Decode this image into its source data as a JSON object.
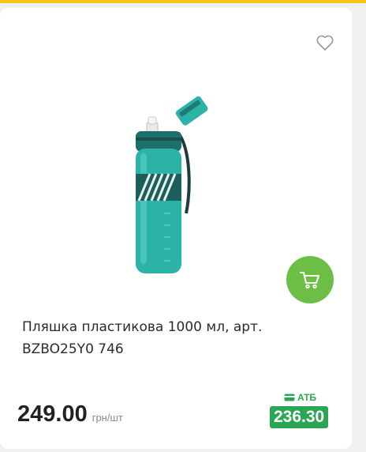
{
  "icons": {
    "favorite": "heart-icon",
    "cart": "cart-icon",
    "atb_card": "card-icon"
  },
  "colors": {
    "accent_bar": "#f5c518",
    "cart_button": "#6cbf44",
    "atb_green": "#2aa655",
    "bottle": "#2ab3a6"
  },
  "product": {
    "title": "Пляшка пластикова 1000 мл, арт. BZBO25Y0 746",
    "price": "249.00",
    "unit": "грн/шт",
    "atb_label": "АТБ",
    "atb_price": "236.30"
  }
}
